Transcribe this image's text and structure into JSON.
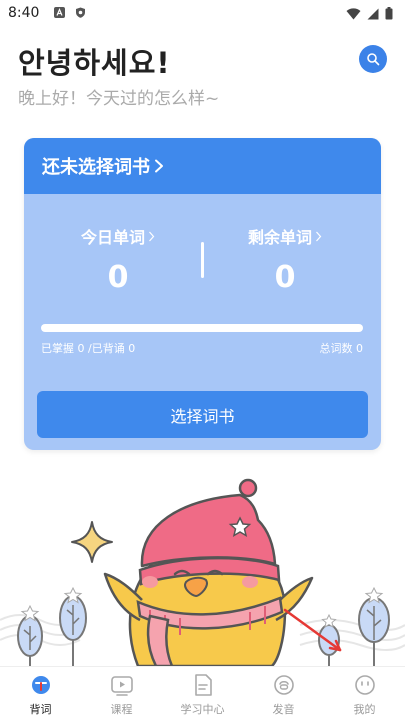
{
  "status_bar": {
    "time": "8:40",
    "icons": [
      "a-app-icon",
      "shield-app-icon",
      "wifi-icon",
      "signal-icon",
      "battery-icon"
    ]
  },
  "header": {
    "greeting": "안녕하세요!",
    "subgreeting": "晚上好！今天过的怎么样~",
    "search_icon": "search-icon"
  },
  "card": {
    "title": "还未选择词书",
    "today_label": "今日单词",
    "today_value": "0",
    "remaining_label": "剩余单词",
    "remaining_value": "0",
    "progress": 0,
    "progress_left": "已掌握 0 /已背诵 0",
    "progress_right": "总词数 0",
    "button_label": "选择词书"
  },
  "tabs": [
    {
      "label": "背词",
      "icon": "flashcard-icon",
      "active": true
    },
    {
      "label": "课程",
      "icon": "play-icon",
      "active": false
    },
    {
      "label": "学习中心",
      "icon": "document-icon",
      "active": false
    },
    {
      "label": "发音",
      "icon": "speech-icon",
      "active": false
    },
    {
      "label": "我的",
      "icon": "profile-icon",
      "active": false
    }
  ],
  "colors": {
    "accent": "#3f89ec",
    "card_body": "#a7c6f7",
    "mascot_hat": "#ef6b86",
    "mascot_body": "#f7c94b"
  }
}
